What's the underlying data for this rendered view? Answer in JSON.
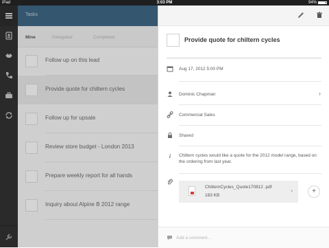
{
  "status_bar": {
    "carrier": "iPad",
    "time": "3:03 PM",
    "battery": "94%"
  },
  "rail": {
    "items": [
      {
        "icon": "menu-icon"
      },
      {
        "icon": "contacts-icon"
      },
      {
        "icon": "deals-icon"
      },
      {
        "icon": "phone-icon"
      },
      {
        "icon": "briefcase-icon"
      },
      {
        "icon": "sync-icon"
      },
      {
        "icon": "wrench-icon"
      }
    ]
  },
  "list": {
    "title": "Tasks",
    "tabs": [
      "Mine",
      "Delegated",
      "Completed"
    ],
    "active_tab": "Mine",
    "tasks": [
      {
        "label": "Follow up on this lead"
      },
      {
        "label": "Provide quote for chiltern cycles"
      },
      {
        "label": "Follow up for upsale"
      },
      {
        "label": "Review store budget - London 2013"
      },
      {
        "label": "Prepare weekly report for all hands"
      },
      {
        "label": "Inquiry about Alpine B 2012 range"
      }
    ],
    "selected_index": 1
  },
  "detail": {
    "title": "Provide quote for chiltern cycles",
    "due": "Aug 17, 2012 5:00 PM",
    "assignee": "Dominic Chapman",
    "related": "Commercial Sales",
    "visibility": "Shared",
    "description": "Chiltern cycles would like a quote for the 2012 model range, based on the ordering from last year.",
    "attachment": {
      "filename": "ChilternCycles_Quote170812 .pdf",
      "size": "183 KB"
    },
    "comment_placeholder": "Add a comment..."
  },
  "colors": {
    "list_header": "#34566f",
    "rail": "#2a2a2a",
    "pdf_accent": "#d63b3b"
  }
}
